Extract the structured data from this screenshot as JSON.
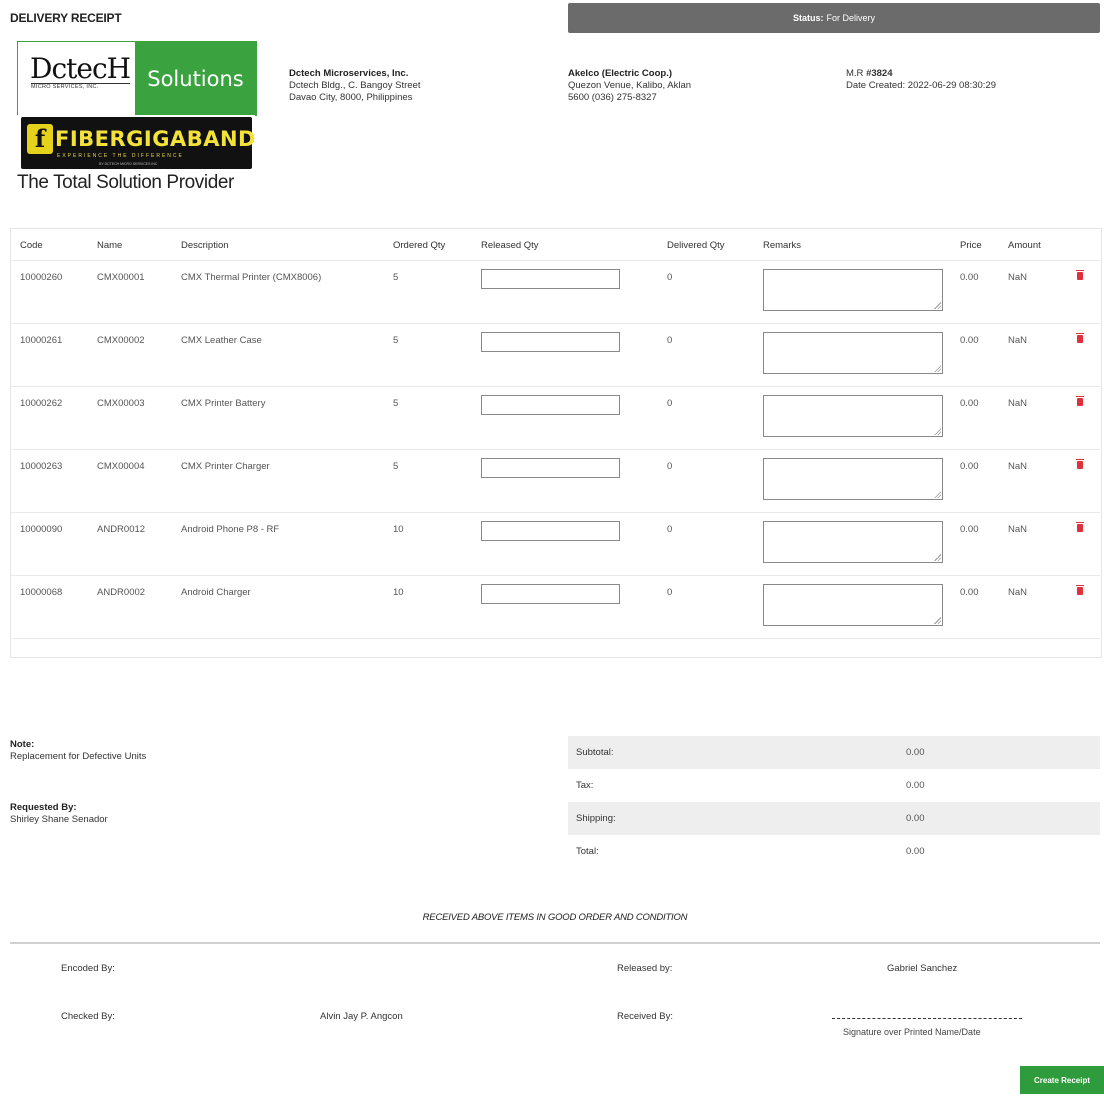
{
  "page": {
    "title": "DELIVERY RECEIPT"
  },
  "status": {
    "label": "Status:",
    "value": "For Delivery",
    "color": "#6b6b6b"
  },
  "logo": {
    "brand": "DctecH",
    "brand_sub": "MICRO SERVICES, INC.",
    "solutions": "Solutions",
    "fiber": "FIBERGIGABAND",
    "fiber_tagline": "EXPERIENCE THE DIFFERENCE",
    "fiber_small": "BY DCTECH MICRO SERVICES INC",
    "tagline": "The Total Solution Provider"
  },
  "company": {
    "name": "Dctech Microservices, Inc.",
    "address1": "Dctech Bldg., C. Bangoy Street",
    "address2": "Davao City, 8000, Philippines"
  },
  "customer": {
    "name": "Akelco (Electric Coop.)",
    "address1": "Quezon Venue, Kalibo, Aklan",
    "address2": "5600 (036) 275-8327"
  },
  "receipt": {
    "mr_label": "M.R",
    "mr_number": "#3824",
    "date_label": "Date Created:",
    "date_value": "2022-06-29 08:30:29"
  },
  "table": {
    "headers": {
      "code": "Code",
      "name": "Name",
      "description": "Description",
      "ordered_qty": "Ordered Qty",
      "released_qty": "Released Qty",
      "delivered_qty": "Delivered Qty",
      "remarks": "Remarks",
      "price": "Price",
      "amount": "Amount"
    },
    "rows": [
      {
        "code": "10000260",
        "name": "CMX00001",
        "description": "CMX Thermal Printer (CMX8006)",
        "ordered": "5",
        "released": "",
        "delivered": "0",
        "remarks": "",
        "price": "0.00",
        "amount": "NaN"
      },
      {
        "code": "10000261",
        "name": "CMX00002",
        "description": "CMX Leather Case",
        "ordered": "5",
        "released": "",
        "delivered": "0",
        "remarks": "",
        "price": "0.00",
        "amount": "NaN"
      },
      {
        "code": "10000262",
        "name": "CMX00003",
        "description": "CMX Printer Battery",
        "ordered": "5",
        "released": "",
        "delivered": "0",
        "remarks": "",
        "price": "0.00",
        "amount": "NaN"
      },
      {
        "code": "10000263",
        "name": "CMX00004",
        "description": "CMX Printer Charger",
        "ordered": "5",
        "released": "",
        "delivered": "0",
        "remarks": "",
        "price": "0.00",
        "amount": "NaN"
      },
      {
        "code": "10000090",
        "name": "ANDR0012",
        "description": "Android Phone P8 - RF",
        "ordered": "10",
        "released": "",
        "delivered": "0",
        "remarks": "",
        "price": "0.00",
        "amount": "NaN"
      },
      {
        "code": "10000068",
        "name": "ANDR0002",
        "description": "Android Charger",
        "ordered": "10",
        "released": "",
        "delivered": "0",
        "remarks": "",
        "price": "0.00",
        "amount": "NaN"
      }
    ]
  },
  "note": {
    "label": "Note:",
    "value": "Replacement for Defective Units"
  },
  "requested": {
    "label": "Requested By:",
    "value": "Shirley Shane Senador"
  },
  "totals": {
    "subtotal_label": "Subtotal:",
    "subtotal": "0.00",
    "tax_label": "Tax:",
    "tax": "0.00",
    "shipping_label": "Shipping:",
    "shipping": "0.00",
    "total_label": "Total:",
    "total": "0.00"
  },
  "received_text": "RECEIVED ABOVE ITEMS IN GOOD ORDER AND CONDITION",
  "signatures": {
    "encoded_label": "Encoded By:",
    "encoded_value": "",
    "released_label": "Released by:",
    "released_value": "Gabriel Sanchez",
    "checked_label": "Checked By:",
    "checked_value": "Alvin Jay P. Angcon",
    "received_label": "Received By:",
    "signature_caption": "Signature over Printed Name/Date"
  },
  "actions": {
    "create_receipt": "Create Receipt",
    "button_color": "#2e9b3c"
  },
  "icons": {
    "delete": "trash-icon",
    "resize": "resize-grip-icon"
  }
}
